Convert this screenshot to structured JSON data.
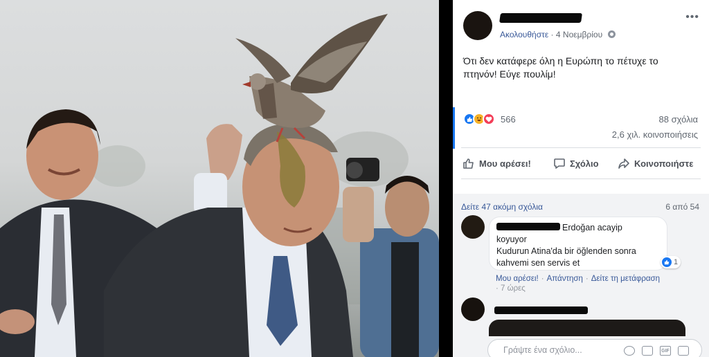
{
  "post": {
    "follow_label": "Ακολουθήστε",
    "date": "4 Νοεμβρίου",
    "more_icon": "more-dots-icon",
    "text_line1": "Ότι δεν κατάφερε όλη η Ευρώπη το πέτυχε το",
    "text_line2": "πτηνόν! Εύγε πουλίμ!",
    "reaction_count": "566",
    "comment_count": "88 σχόλια",
    "share_count": "2,6 χιλ. κοινοποιήσεις"
  },
  "actions": {
    "like": "Μου αρέσει!",
    "comment": "Σχόλιο",
    "share": "Κοινοποιήστε"
  },
  "comments": {
    "view_more": "Δείτε 47 ακόμη σχόλια",
    "count_of": "6 από 54",
    "first": {
      "line1": "Erdoğan acayip",
      "line2": "koyuyor",
      "line3": "Kudurun Atina'da bir öğlenden sonra",
      "line4": "kahvemi sen servis et",
      "likes": "1",
      "like_action": "Μου αρέσει!",
      "reply_action": "Απάντηση",
      "translate_action": "Δείτε τη μετάφραση",
      "time": "7 ώρες"
    }
  },
  "composer": {
    "placeholder": "Γράψτε ένα σχόλιο..."
  },
  "colors": {
    "link_blue": "#385898",
    "facebook_blue": "#1877f2",
    "love_red": "#f33e58",
    "haha_yellow": "#f7b125"
  }
}
